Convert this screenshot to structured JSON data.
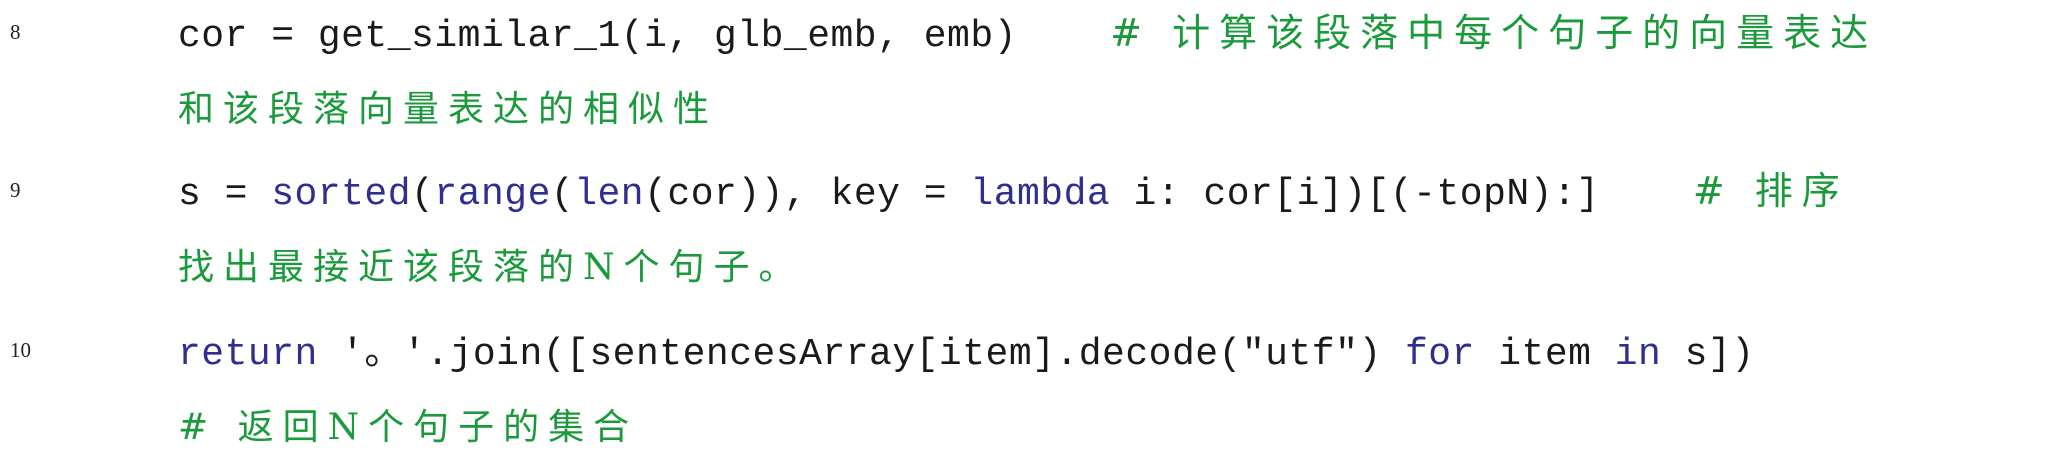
{
  "lines": [
    {
      "number": "8",
      "code": "cor = get_similar_1(i, glb_emb, emb)    ",
      "comment": "# 计算该段落中每个句子的向量表达",
      "continuation": "和该段落向量表达的相似性"
    },
    {
      "number": "9",
      "parts": {
        "p1": "s = ",
        "kw_sorted": "sorted",
        "p2": "(",
        "kw_range": "range",
        "p3": "(",
        "kw_len": "len",
        "p4": "(cor)), key = ",
        "kw_lambda": "lambda",
        "p5": " i: cor[i])[(-topN):]    "
      },
      "comment": "# 排序",
      "continuation": "找出最接近该段落的N个句子。"
    },
    {
      "number": "10",
      "parts": {
        "kw_return": "return",
        "p1": " '。'.join([sentencesArray[item].decode(\"utf\") ",
        "kw_for": "for",
        "p2": " item ",
        "kw_in": "in",
        "p3": " s])"
      },
      "continuation": "# 返回N个句子的集合"
    }
  ],
  "colors": {
    "keyword": "#2f2f8f",
    "comment": "#1a9a3a",
    "text": "#1a1a1a"
  }
}
